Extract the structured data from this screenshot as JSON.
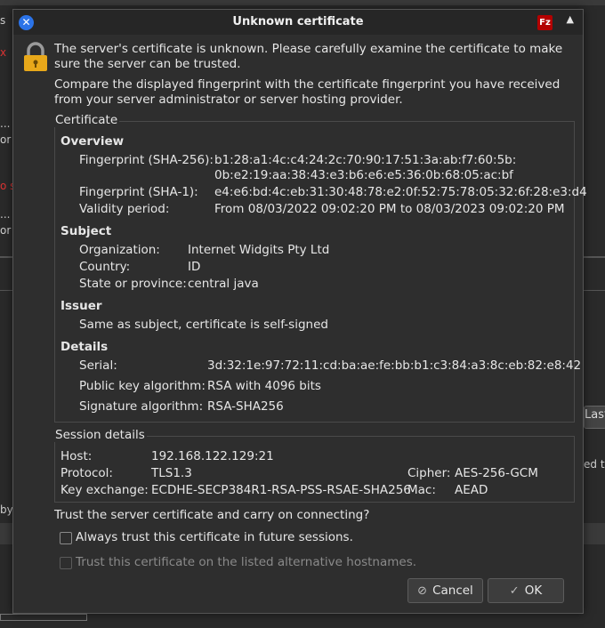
{
  "dialog": {
    "title": "Unknown certificate",
    "app_icon_text": "Fz",
    "intro1": "The server's certificate is unknown. Please carefully examine the certificate to make sure the server can be trusted.",
    "intro2": "Compare the displayed fingerprint with the certificate fingerprint you have received from your server administrator or server hosting provider."
  },
  "certificate": {
    "group_label": "Certificate",
    "overview": {
      "heading": "Overview",
      "sha256_label": "Fingerprint (SHA-256):",
      "sha256_value_line1": "b1:28:a1:4c:c4:24:2c:70:90:17:51:3a:ab:f7:60:5b:",
      "sha256_value_line2": "0b:e2:19:aa:38:43:e3:b6:e6:e5:36:0b:68:05:ac:bf",
      "sha1_label": "Fingerprint (SHA-1):",
      "sha1_value": "e4:e6:bd:4c:eb:31:30:48:78:e2:0f:52:75:78:05:32:6f:28:e3:d4",
      "validity_label": "Validity period:",
      "validity_value": "From 08/03/2022 09:02:20 PM to 08/03/2023 09:02:20 PM"
    },
    "subject": {
      "heading": "Subject",
      "org_label": "Organization:",
      "org_value": "Internet Widgits Pty Ltd",
      "country_label": "Country:",
      "country_value": "ID",
      "state_label": "State or province:",
      "state_value": "central java"
    },
    "issuer": {
      "heading": "Issuer",
      "value": "Same as subject, certificate is self-signed"
    },
    "details": {
      "heading": "Details",
      "serial_label": "Serial:",
      "serial_value": "3d:32:1e:97:72:11:cd:ba:ae:fe:bb:b1:c3:84:a3:8c:eb:82:e8:42",
      "pubkey_label": "Public key algorithm:",
      "pubkey_value": "RSA with 4096 bits",
      "sig_label": "Signature algorithm:",
      "sig_value": "RSA-SHA256"
    }
  },
  "session": {
    "group_label": "Session details",
    "host_label": "Host:",
    "host_value": "192.168.122.129:21",
    "protocol_label": "Protocol:",
    "protocol_value": "TLS1.3",
    "cipher_label": "Cipher:",
    "cipher_value": "AES-256-GCM",
    "kex_label": "Key exchange:",
    "kex_value": "ECDHE-SECP384R1-RSA-PSS-RSAE-SHA256",
    "mac_label": "Mac:",
    "mac_value": "AEAD"
  },
  "trust": {
    "question": "Trust the server certificate and carry on connecting?",
    "always_trust": "Always trust this certificate in future sessions.",
    "alt_hostnames": "Trust this certificate on the listed alternative hostnames."
  },
  "buttons": {
    "cancel": "Cancel",
    "ok": "OK"
  },
  "background": {
    "frag_s": "s",
    "frag_x": "x",
    "frag_dots1": "...",
    "frag_or1": "or",
    "frag_red": "o s",
    "frag_dots2": "...",
    "frag_or2": "or",
    "frag_last": "Last",
    "frag_edte": "ed te",
    "frag_by": "by"
  }
}
